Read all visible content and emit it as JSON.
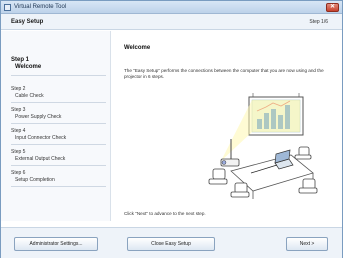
{
  "window": {
    "title": "Virtual Remote Tool",
    "close_label": "✕"
  },
  "header": {
    "title": "Easy Setup",
    "step_indicator": "Step 1/6"
  },
  "sidebar": {
    "steps": [
      {
        "num": "Step 1",
        "name": "Welcome"
      },
      {
        "num": "Step 2",
        "name": "Cable Check"
      },
      {
        "num": "Step 3",
        "name": "Power Supply Check"
      },
      {
        "num": "Step 4",
        "name": "Input Connector Check"
      },
      {
        "num": "Step 5",
        "name": "External Output Check"
      },
      {
        "num": "Step 6",
        "name": "Setup Completion"
      }
    ]
  },
  "content": {
    "title": "Welcome",
    "description": "The \"Easy Setup\" performs the connections between the computer that you are now using and the projector in 6 steps.",
    "hint": "Click \"Next\" to advance to the next step."
  },
  "footer": {
    "admin_label": "Administrator Settings...",
    "close_label": "Close Easy Setup",
    "next_label": "Next >"
  },
  "colors": {
    "accent": "#4a6f9a",
    "close_button": "#c6412d",
    "screen": "#e8f3e6"
  }
}
